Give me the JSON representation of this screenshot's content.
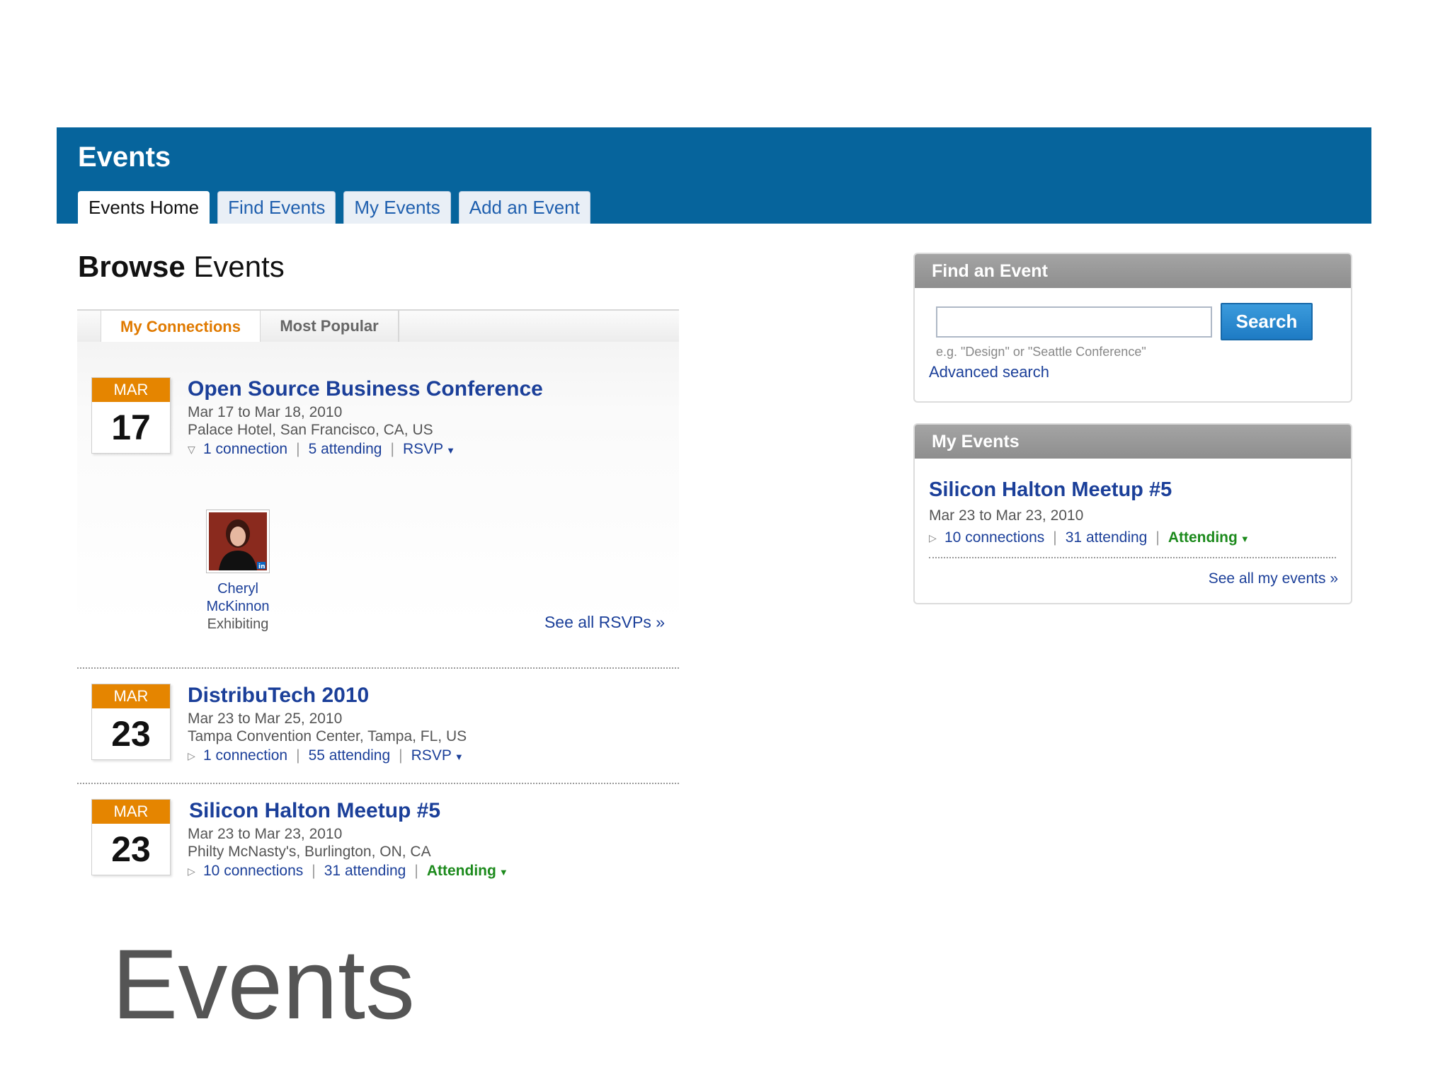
{
  "header": {
    "title": "Events",
    "tabs": [
      {
        "label": "Events Home",
        "active": true
      },
      {
        "label": "Find Events",
        "active": false
      },
      {
        "label": "My Events",
        "active": false
      },
      {
        "label": "Add an Event",
        "active": false
      }
    ]
  },
  "browse": {
    "title_bold": "Browse",
    "title_rest": " Events",
    "tabs": [
      {
        "label": "My Connections",
        "active": true
      },
      {
        "label": "Most Popular",
        "active": false
      }
    ],
    "events": [
      {
        "month": "MAR",
        "day": "17",
        "title": "Open Source Business Conference",
        "dates": "Mar 17 to Mar 18, 2010",
        "location": "Palace Hotel, San Francisco, CA, US",
        "expand_icon": "triangle-down-icon",
        "connections": "1 connection",
        "attending": "5 attending",
        "action": "RSVP",
        "person": {
          "name_line1": "Cheryl",
          "name_line2": "McKinnon",
          "status": "Exhibiting"
        },
        "see_all": "See all RSVPs »"
      },
      {
        "month": "MAR",
        "day": "23",
        "title": "DistribuTech 2010",
        "dates": "Mar 23 to Mar 25, 2010",
        "location": "Tampa Convention Center, Tampa, FL, US",
        "expand_icon": "triangle-right-icon",
        "connections": "1 connection",
        "attending": "55 attending",
        "action": "RSVP"
      },
      {
        "month": "MAR",
        "day": "23",
        "title": "Silicon Halton Meetup #5",
        "dates": "Mar 23 to Mar 23, 2010",
        "location": "Philty McNasty's, Burlington, ON, CA",
        "expand_icon": "triangle-right-icon",
        "connections": "10 connections",
        "attending": "31 attending",
        "action": "Attending"
      }
    ]
  },
  "find_panel": {
    "title": "Find an Event",
    "search_value": "",
    "search_button": "Search",
    "hint": "e.g. \"Design\" or \"Seattle Conference\"",
    "advanced": "Advanced search"
  },
  "my_events_panel": {
    "title": "My Events",
    "event_title": "Silicon Halton Meetup #5",
    "event_dates": "Mar 23 to Mar 23, 2010",
    "connections": "10 connections",
    "attending": "31 attending",
    "status": "Attending",
    "see_all": "See all my events »"
  },
  "caption": "Events",
  "colors": {
    "header_bg": "#06649c",
    "date_badge": "#e58500",
    "link": "#1b3f99",
    "attending": "#1c8a1c",
    "active_subtab": "#e07a00"
  }
}
